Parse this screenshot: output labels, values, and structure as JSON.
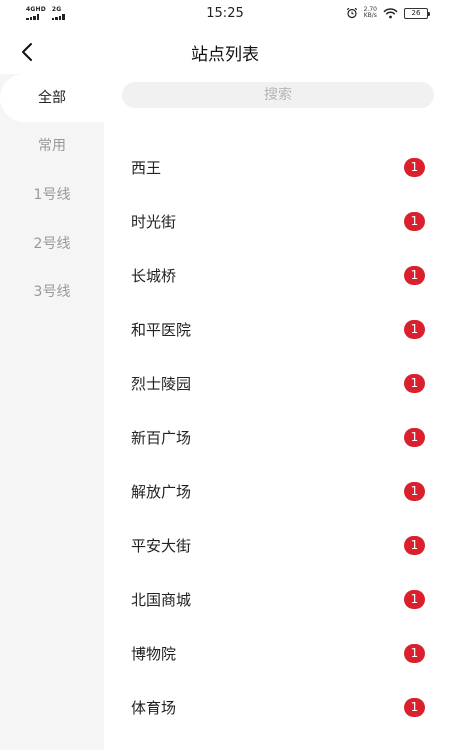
{
  "status_bar": {
    "network_1": "4GHD",
    "network_2": "2G",
    "time": "15:25",
    "speed_value": "2.70",
    "speed_unit": "KB/s",
    "battery": "26",
    "alarm_icon": "alarm-clock-icon",
    "wifi_icon": "wifi-icon"
  },
  "header": {
    "title": "站点列表",
    "back_icon": "chevron-left-icon"
  },
  "sidebar": {
    "items": [
      {
        "label": "全部",
        "active": true
      },
      {
        "label": "常用",
        "active": false
      },
      {
        "label": "1号线",
        "active": false
      },
      {
        "label": "2号线",
        "active": false
      },
      {
        "label": "3号线",
        "active": false
      }
    ]
  },
  "search": {
    "placeholder": "搜索"
  },
  "colors": {
    "badge": "#d9202c",
    "sidebar_bg": "#f5f5f5",
    "search_bg": "#f1f1f1"
  },
  "stations": [
    {
      "name": "西王",
      "badge": "1"
    },
    {
      "name": "时光街",
      "badge": "1"
    },
    {
      "name": "长城桥",
      "badge": "1"
    },
    {
      "name": "和平医院",
      "badge": "1"
    },
    {
      "name": "烈士陵园",
      "badge": "1"
    },
    {
      "name": "新百广场",
      "badge": "1"
    },
    {
      "name": "解放广场",
      "badge": "1"
    },
    {
      "name": "平安大街",
      "badge": "1"
    },
    {
      "name": "北国商城",
      "badge": "1"
    },
    {
      "name": "博物院",
      "badge": "1"
    },
    {
      "name": "体育场",
      "badge": "1"
    }
  ]
}
